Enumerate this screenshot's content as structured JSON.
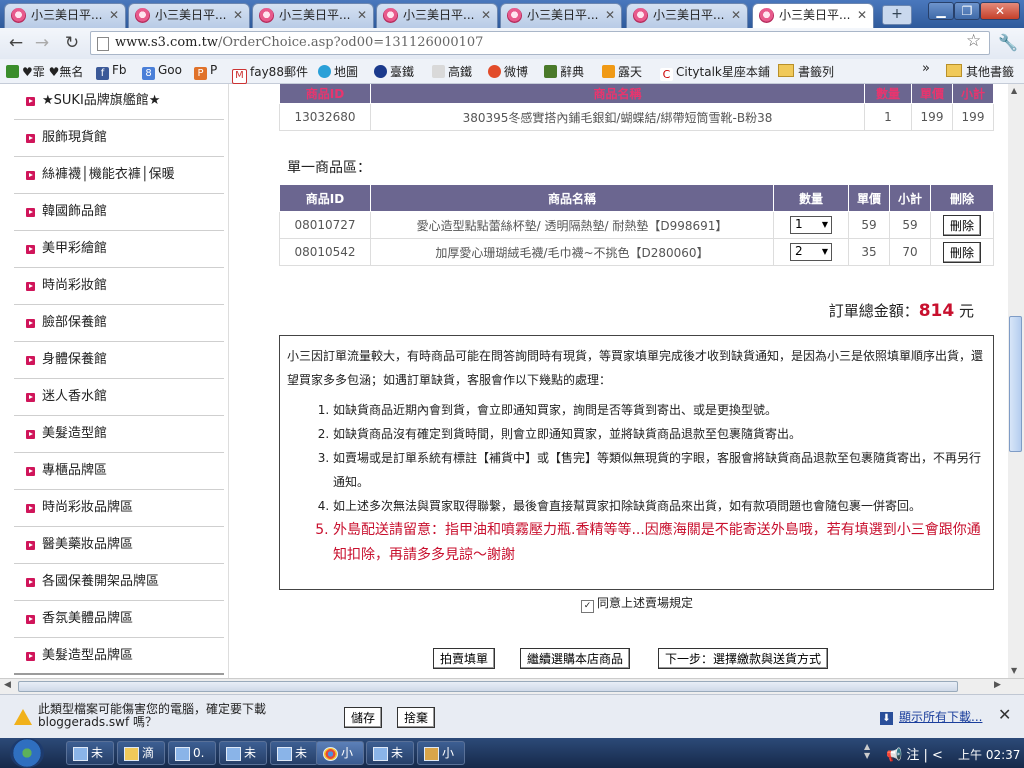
{
  "browser": {
    "tabs": [
      {
        "label": "小三美日平..."
      },
      {
        "label": "小三美日平..."
      },
      {
        "label": "小三美日平..."
      },
      {
        "label": "小三美日平..."
      },
      {
        "label": "小三美日平..."
      },
      {
        "label": "小三美日平..."
      },
      {
        "label": "小三美日平...",
        "active": true
      }
    ],
    "new_tab": "+",
    "url_host": "www.s3.com.tw",
    "url_path": "/OrderChoice.asp?od00=131126000107",
    "bookmarks": [
      {
        "label": "♥霏 ♥無名",
        "icon": "bookmark-icon-green"
      },
      {
        "label": "Fb",
        "icon": "facebook-icon"
      },
      {
        "label": "Goo",
        "icon": "google-icon"
      },
      {
        "label": "P",
        "icon": "pixnet-icon"
      },
      {
        "label": "fay88郵件",
        "icon": "gmail-icon"
      },
      {
        "label": "地圖",
        "icon": "map-icon"
      },
      {
        "label": "臺鐵",
        "icon": "railway-icon"
      },
      {
        "label": "高鐵",
        "icon": "hsr-icon"
      },
      {
        "label": "微博",
        "icon": "weibo-icon"
      },
      {
        "label": "辭典",
        "icon": "dictionary-icon"
      },
      {
        "label": "露天",
        "icon": "ruten-icon"
      },
      {
        "label": "Citytalk星座本鋪",
        "icon": "citytalk-icon"
      },
      {
        "label": "書籤列",
        "icon": "folder-icon"
      }
    ],
    "bookmarks_more": "»",
    "other_bookmarks": "其他書籤"
  },
  "sidebar": {
    "items": [
      "★SUKI品牌旗艦館★",
      "服飾現貨館",
      "絲褲襪│機能衣褲│保暖",
      "韓國飾品館",
      "美甲彩繪館",
      "時尚彩妝館",
      "臉部保養館",
      "身體保養館",
      "迷人香水館",
      "美髮造型館",
      "專櫃品牌區",
      "時尚彩妝品牌區",
      "醫美藥妝品牌區",
      "各國保養開架品牌區",
      "香氛美體品牌區",
      "美髮造型品牌區"
    ]
  },
  "top_table": {
    "headers": [
      "商品ID",
      "商品名稱",
      "數量",
      "單價",
      "小計"
    ],
    "rows": [
      {
        "id": "13032680",
        "name": "380395冬感實搭內鋪毛銀釦/蝴蝶結/綁帶短筒雪靴-B粉38",
        "qty": "1",
        "price": "199",
        "subtotal": "199"
      }
    ]
  },
  "single": {
    "label": "單一商品區：",
    "headers": [
      "商品ID",
      "商品名稱",
      "數量",
      "單價",
      "小計",
      "刪除"
    ],
    "rows": [
      {
        "id": "08010727",
        "name": "愛心造型點點蕾絲杯墊/ 透明隔熱墊/ 耐熱墊【D998691】",
        "qty": "1",
        "price": "59",
        "subtotal": "59",
        "delete": "刪除"
      },
      {
        "id": "08010542",
        "name": "加厚愛心珊瑚絨毛襪/毛巾襪~不挑色【D280060】",
        "qty": "2",
        "price": "35",
        "subtotal": "70",
        "delete": "刪除"
      }
    ]
  },
  "total": {
    "label": "訂單總金額：",
    "amount": "814",
    "unit": "元"
  },
  "notice": {
    "intro": "小三因訂單流量較大，有時商品可能在問答詢問時有現貨，等買家填單完成後才收到缺貨通知，是因為小三是依照填單順序出貨，還望買家多多包涵；如遇訂單缺貨，客服會作以下幾點的處理：",
    "items": [
      "如缺貨商品近期內會到貨，會立即通知買家，詢問是否等貨到寄出、或是更換型號。",
      "如缺貨商品沒有確定到貨時間，則會立即通知買家，並將缺貨商品退款至包裹隨貨寄出。",
      "如賣場或是訂單系統有標註【補貨中】或【售完】等類似無現貨的字眼，客服會將缺貨商品退款至包裹隨貨寄出，不再另行通知。",
      "如上述多次無法與買家取得聯繫，最後會直接幫買家扣除缺貨商品來出貨，如有款項問題也會隨包裹一併寄回。",
      "外島配送請留意：指甲油和噴霧壓力瓶.香精等等...因應海關是不能寄送外島哦，若有填選到小三會跟你通知扣除，再請多多見諒～謝謝"
    ]
  },
  "agree": {
    "label": "同意上述賣場規定",
    "checked": "✓"
  },
  "actions": {
    "auction": "拍賣填單",
    "continue": "繼續選購本店商品",
    "next": "下一步：選擇繳款與送貨方式"
  },
  "download_bar": {
    "message": "此類型檔案可能傷害您的電腦，確定要下載 bloggerads.swf 嗎？",
    "save": "儲存",
    "discard": "捨棄",
    "show_all": "顯示所有下載...",
    "close": "✕"
  },
  "taskbar": {
    "items": [
      {
        "label": "未"
      },
      {
        "label": "滴"
      },
      {
        "label": "0."
      },
      {
        "label": "未"
      },
      {
        "label": "未"
      },
      {
        "label": "小"
      },
      {
        "label": "未"
      },
      {
        "label": "小"
      }
    ],
    "ime": "📢 注 |  <",
    "clock": "上午 02:37"
  },
  "colors": {
    "header_bg": "#6b6690",
    "accent_red": "#c8102e",
    "sidebar_arrow": "#d0155a"
  }
}
